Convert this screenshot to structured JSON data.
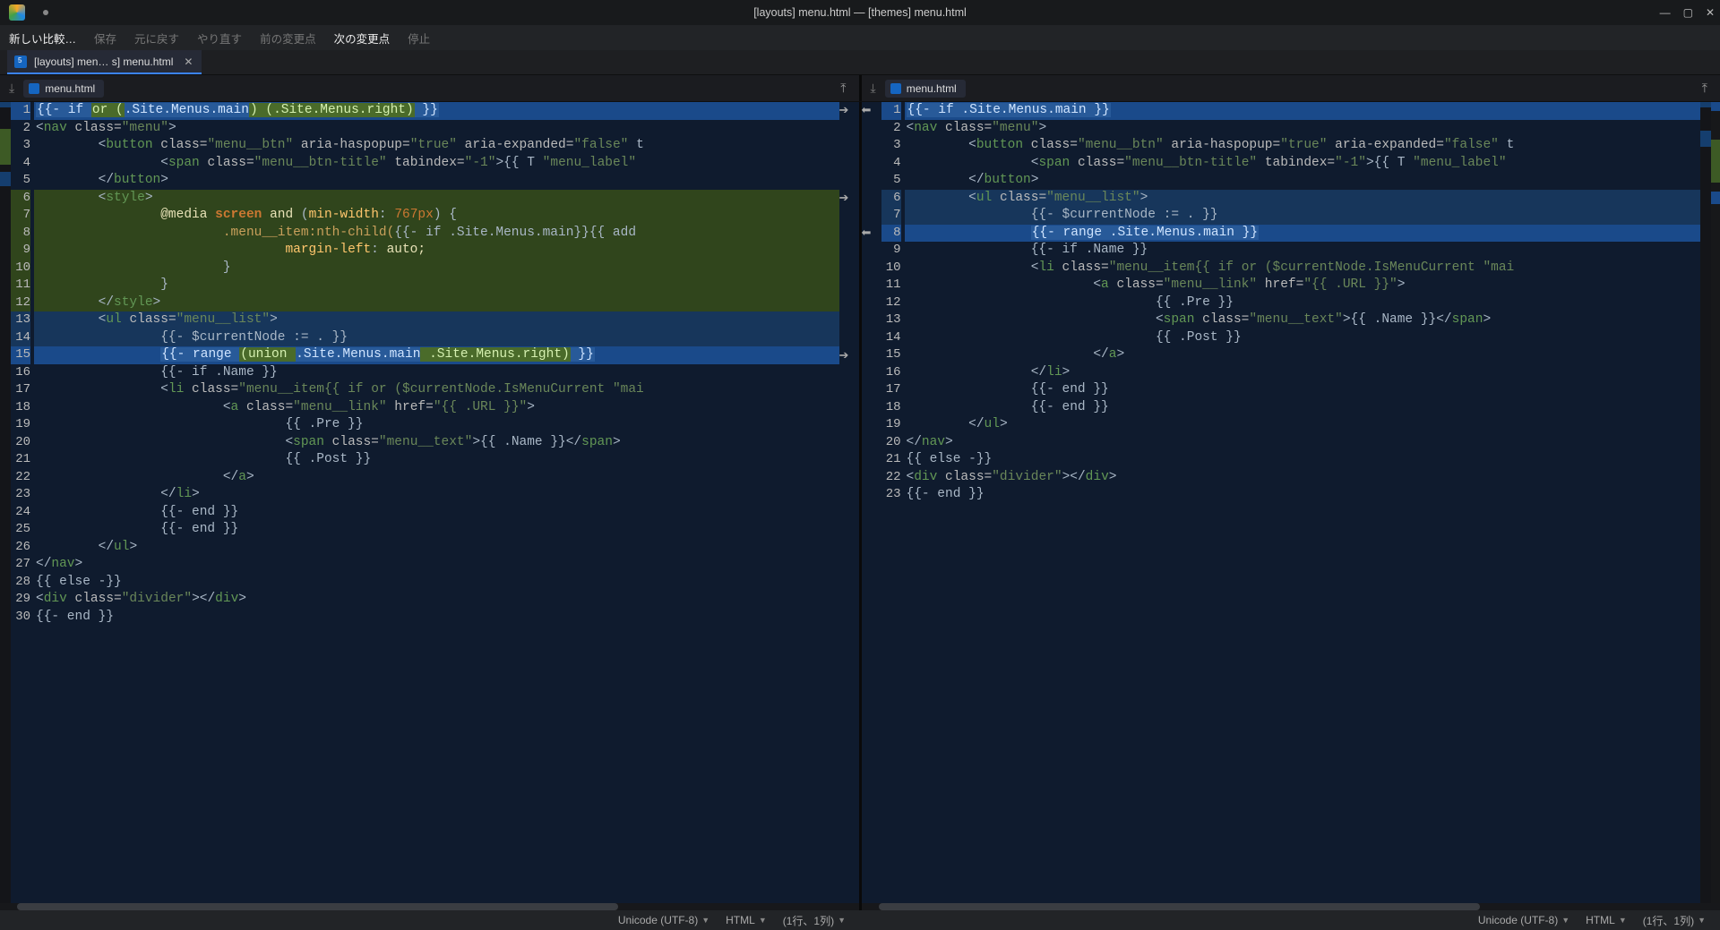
{
  "window_title": "[layouts] menu.html — [themes] menu.html",
  "toolbar": {
    "new_compare": "新しい比較…",
    "save": "保存",
    "undo": "元に戻す",
    "redo": "やり直す",
    "prev_change": "前の変更点",
    "next_change": "次の変更点",
    "stop": "停止"
  },
  "tab": {
    "label": "[layouts] men… s] menu.html"
  },
  "left_file": "menu.html",
  "right_file": "menu.html",
  "status": {
    "encoding": "Unicode (UTF-8)",
    "language": "HTML",
    "cursor": "(1行、1列)"
  },
  "left_code": [
    {
      "n": 1,
      "cls": "hl-change sel",
      "html": "<span class='inline-edit'>{{- if <span class='inline-add'>or (</span>.Site.Menus.main<span class='inline-add'>) (.Site.Menus.right)</span> }}</span>"
    },
    {
      "n": 2,
      "cls": "",
      "html": "<span class='tok-pun'>&lt;</span><span class='tok-tag'>nav</span> <span class='tok-attr'>class=</span><span class='tok-str'>\"menu\"</span><span class='tok-pun'>&gt;</span>"
    },
    {
      "n": 3,
      "cls": "",
      "html": "        <span class='tok-pun'>&lt;</span><span class='tok-tag'>button</span> <span class='tok-attr'>class=</span><span class='tok-str'>\"menu__btn\"</span> <span class='tok-attr'>aria-haspopup=</span><span class='tok-str'>\"true\"</span> <span class='tok-attr'>aria-expanded=</span><span class='tok-str'>\"false\"</span> t"
    },
    {
      "n": 4,
      "cls": "",
      "html": "                <span class='tok-pun'>&lt;</span><span class='tok-tag'>span</span> <span class='tok-attr'>class=</span><span class='tok-str'>\"menu__btn-title\"</span> <span class='tok-attr'>tabindex=</span><span class='tok-str'>\"-1\"</span><span class='tok-pun'>&gt;</span>{{ T <span class='tok-str'>\"menu_label\"</span>"
    },
    {
      "n": 5,
      "cls": "",
      "html": "        <span class='tok-pun'>&lt;/</span><span class='tok-tag'>button</span><span class='tok-pun'>&gt;</span>"
    },
    {
      "n": 6,
      "cls": "hl-added",
      "html": "        <span class='tok-pun'>&lt;</span><span class='tok-tag'>style</span><span class='tok-pun'>&gt;</span>"
    },
    {
      "n": 7,
      "cls": "hl-added",
      "html": "                <span class='tok-media'>@media</span> <span class='tok-kw'>screen</span> <span class='tok-media'>and</span> <span class='tok-pun'>(</span><span class='tok-func'>min-width</span><span class='tok-pun'>:</span> <span class='tok-num'>767px</span><span class='tok-pun'>) {</span>"
    },
    {
      "n": 8,
      "cls": "hl-added",
      "html": "                        <span class='tok-prop'>.menu__item:nth-child(</span>{{- if .Site.Menus.main}}{{ add"
    },
    {
      "n": 9,
      "cls": "hl-added",
      "html": "                                <span class='tok-func'>margin-left</span><span class='tok-pun'>:</span> <span class='tok-txt'>auto;</span>"
    },
    {
      "n": 10,
      "cls": "hl-added",
      "html": "                        <span class='tok-pun'>}</span>"
    },
    {
      "n": 11,
      "cls": "hl-added",
      "html": "                <span class='tok-pun'>}</span>"
    },
    {
      "n": 12,
      "cls": "hl-added",
      "html": "        <span class='tok-pun'>&lt;/</span><span class='tok-tag'>style</span><span class='tok-pun'>&gt;</span>"
    },
    {
      "n": 13,
      "cls": "hl-change",
      "html": "        <span class='tok-pun'>&lt;</span><span class='tok-tag'>ul</span> <span class='tok-attr'>class=</span><span class='tok-str'>\"menu__list\"</span><span class='tok-pun'>&gt;</span>"
    },
    {
      "n": 14,
      "cls": "hl-change",
      "html": "                {{- $currentNode := . }}"
    },
    {
      "n": 15,
      "cls": "hl-change sel",
      "html": "                <span class='inline-edit'>{{- range <span class='inline-add'>(union </span>.Site.Menus.main<span class='inline-add'> .Site.Menus.right)</span> }}</span>"
    },
    {
      "n": 16,
      "cls": "",
      "html": "                {{- if .Name }}"
    },
    {
      "n": 17,
      "cls": "",
      "html": "                <span class='tok-pun'>&lt;</span><span class='tok-tag'>li</span> <span class='tok-attr'>class=</span><span class='tok-str'>\"menu__item{{ if or ($currentNode.IsMenuCurrent </span><span class='tok-str'>\"mai</span>"
    },
    {
      "n": 18,
      "cls": "",
      "html": "                        <span class='tok-pun'>&lt;</span><span class='tok-tag'>a</span> <span class='tok-attr'>class=</span><span class='tok-str'>\"menu__link\"</span> <span class='tok-attr'>href=</span><span class='tok-str'>\"{{ .URL }}\"</span><span class='tok-pun'>&gt;</span>"
    },
    {
      "n": 19,
      "cls": "",
      "html": "                                {{ .Pre }}"
    },
    {
      "n": 20,
      "cls": "",
      "html": "                                <span class='tok-pun'>&lt;</span><span class='tok-tag'>span</span> <span class='tok-attr'>class=</span><span class='tok-str'>\"menu__text\"</span><span class='tok-pun'>&gt;</span>{{ .Name }}<span class='tok-pun'>&lt;/</span><span class='tok-tag'>span</span><span class='tok-pun'>&gt;</span>"
    },
    {
      "n": 21,
      "cls": "",
      "html": "                                {{ .Post }}"
    },
    {
      "n": 22,
      "cls": "",
      "html": "                        <span class='tok-pun'>&lt;/</span><span class='tok-tag'>a</span><span class='tok-pun'>&gt;</span>"
    },
    {
      "n": 23,
      "cls": "",
      "html": "                <span class='tok-pun'>&lt;/</span><span class='tok-tag'>li</span><span class='tok-pun'>&gt;</span>"
    },
    {
      "n": 24,
      "cls": "",
      "html": "                {{- end }}"
    },
    {
      "n": 25,
      "cls": "",
      "html": "                {{- end }}"
    },
    {
      "n": 26,
      "cls": "",
      "html": "        <span class='tok-pun'>&lt;/</span><span class='tok-tag'>ul</span><span class='tok-pun'>&gt;</span>"
    },
    {
      "n": 27,
      "cls": "",
      "html": "<span class='tok-pun'>&lt;/</span><span class='tok-tag'>nav</span><span class='tok-pun'>&gt;</span>"
    },
    {
      "n": 28,
      "cls": "",
      "html": "{{ else -}}"
    },
    {
      "n": 29,
      "cls": "",
      "html": "<span class='tok-pun'>&lt;</span><span class='tok-tag'>div</span> <span class='tok-attr'>class=</span><span class='tok-str'>\"divider\"</span><span class='tok-pun'>&gt;&lt;/</span><span class='tok-tag'>div</span><span class='tok-pun'>&gt;</span>"
    },
    {
      "n": 30,
      "cls": "",
      "html": "{{- end }}"
    }
  ],
  "right_code": [
    {
      "n": 1,
      "cls": "hl-change sel",
      "html": "<span class='inline-edit'>{{- if .Site.Menus.main }}</span>"
    },
    {
      "n": 2,
      "cls": "",
      "html": "<span class='tok-pun'>&lt;</span><span class='tok-tag'>nav</span> <span class='tok-attr'>class=</span><span class='tok-str'>\"menu\"</span><span class='tok-pun'>&gt;</span>"
    },
    {
      "n": 3,
      "cls": "",
      "html": "        <span class='tok-pun'>&lt;</span><span class='tok-tag'>button</span> <span class='tok-attr'>class=</span><span class='tok-str'>\"menu__btn\"</span> <span class='tok-attr'>aria-haspopup=</span><span class='tok-str'>\"true\"</span> <span class='tok-attr'>aria-expanded=</span><span class='tok-str'>\"false\"</span> t"
    },
    {
      "n": 4,
      "cls": "",
      "html": "                <span class='tok-pun'>&lt;</span><span class='tok-tag'>span</span> <span class='tok-attr'>class=</span><span class='tok-str'>\"menu__btn-title\"</span> <span class='tok-attr'>tabindex=</span><span class='tok-str'>\"-1\"</span><span class='tok-pun'>&gt;</span>{{ T <span class='tok-str'>\"menu_label\"</span>"
    },
    {
      "n": 5,
      "cls": "",
      "html": "        <span class='tok-pun'>&lt;/</span><span class='tok-tag'>button</span><span class='tok-pun'>&gt;</span>"
    },
    {
      "n": 6,
      "cls": "hl-change",
      "html": "        <span class='tok-pun'>&lt;</span><span class='tok-tag'>ul</span> <span class='tok-attr'>class=</span><span class='tok-str'>\"menu__list\"</span><span class='tok-pun'>&gt;</span>"
    },
    {
      "n": 7,
      "cls": "hl-change",
      "html": "                {{- $currentNode := . }}"
    },
    {
      "n": 8,
      "cls": "hl-change sel",
      "html": "                <span class='inline-edit'>{{- range .Site.Menus.main }}</span>"
    },
    {
      "n": 9,
      "cls": "",
      "html": "                {{- if .Name }}"
    },
    {
      "n": 10,
      "cls": "",
      "html": "                <span class='tok-pun'>&lt;</span><span class='tok-tag'>li</span> <span class='tok-attr'>class=</span><span class='tok-str'>\"menu__item{{ if or ($currentNode.IsMenuCurrent </span><span class='tok-str'>\"mai</span>"
    },
    {
      "n": 11,
      "cls": "",
      "html": "                        <span class='tok-pun'>&lt;</span><span class='tok-tag'>a</span> <span class='tok-attr'>class=</span><span class='tok-str'>\"menu__link\"</span> <span class='tok-attr'>href=</span><span class='tok-str'>\"{{ .URL }}\"</span><span class='tok-pun'>&gt;</span>"
    },
    {
      "n": 12,
      "cls": "",
      "html": "                                {{ .Pre }}"
    },
    {
      "n": 13,
      "cls": "",
      "html": "                                <span class='tok-pun'>&lt;</span><span class='tok-tag'>span</span> <span class='tok-attr'>class=</span><span class='tok-str'>\"menu__text\"</span><span class='tok-pun'>&gt;</span>{{ .Name }}<span class='tok-pun'>&lt;/</span><span class='tok-tag'>span</span><span class='tok-pun'>&gt;</span>"
    },
    {
      "n": 14,
      "cls": "",
      "html": "                                {{ .Post }}"
    },
    {
      "n": 15,
      "cls": "",
      "html": "                        <span class='tok-pun'>&lt;/</span><span class='tok-tag'>a</span><span class='tok-pun'>&gt;</span>"
    },
    {
      "n": 16,
      "cls": "",
      "html": "                <span class='tok-pun'>&lt;/</span><span class='tok-tag'>li</span><span class='tok-pun'>&gt;</span>"
    },
    {
      "n": 17,
      "cls": "",
      "html": "                {{- end }}"
    },
    {
      "n": 18,
      "cls": "",
      "html": "                {{- end }}"
    },
    {
      "n": 19,
      "cls": "",
      "html": "        <span class='tok-pun'>&lt;/</span><span class='tok-tag'>ul</span><span class='tok-pun'>&gt;</span>"
    },
    {
      "n": 20,
      "cls": "",
      "html": "<span class='tok-pun'>&lt;/</span><span class='tok-tag'>nav</span><span class='tok-pun'>&gt;</span>"
    },
    {
      "n": 21,
      "cls": "",
      "html": "{{ else -}}"
    },
    {
      "n": 22,
      "cls": "",
      "html": "<span class='tok-pun'>&lt;</span><span class='tok-tag'>div</span> <span class='tok-attr'>class=</span><span class='tok-str'>\"divider\"</span><span class='tok-pun'>&gt;&lt;/</span><span class='tok-tag'>div</span><span class='tok-pun'>&gt;</span>"
    },
    {
      "n": 23,
      "cls": "",
      "html": "{{- end }}"
    }
  ]
}
